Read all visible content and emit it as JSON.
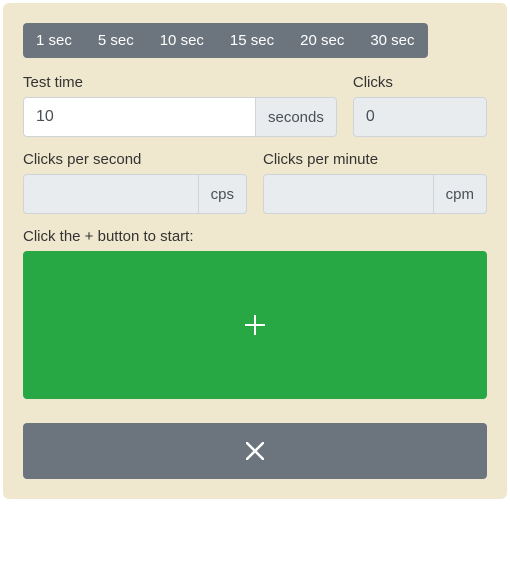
{
  "presets": {
    "items": [
      {
        "label": "1 sec"
      },
      {
        "label": "5 sec"
      },
      {
        "label": "10 sec"
      },
      {
        "label": "15 sec"
      },
      {
        "label": "20 sec"
      },
      {
        "label": "30 sec"
      }
    ]
  },
  "fields": {
    "test_time": {
      "label": "Test time",
      "value": "10",
      "unit": "seconds"
    },
    "clicks": {
      "label": "Clicks",
      "value": "0"
    },
    "cps": {
      "label": "Clicks per second",
      "value": "",
      "unit": "cps"
    },
    "cpm": {
      "label": "Clicks per minute",
      "value": "",
      "unit": "cpm"
    }
  },
  "instruction": "Click the + button to start:",
  "colors": {
    "panel_bg": "#efe8ce",
    "preset_bg": "#6c757d",
    "start_btn": "#28a745",
    "reset_btn": "#6c757d"
  }
}
